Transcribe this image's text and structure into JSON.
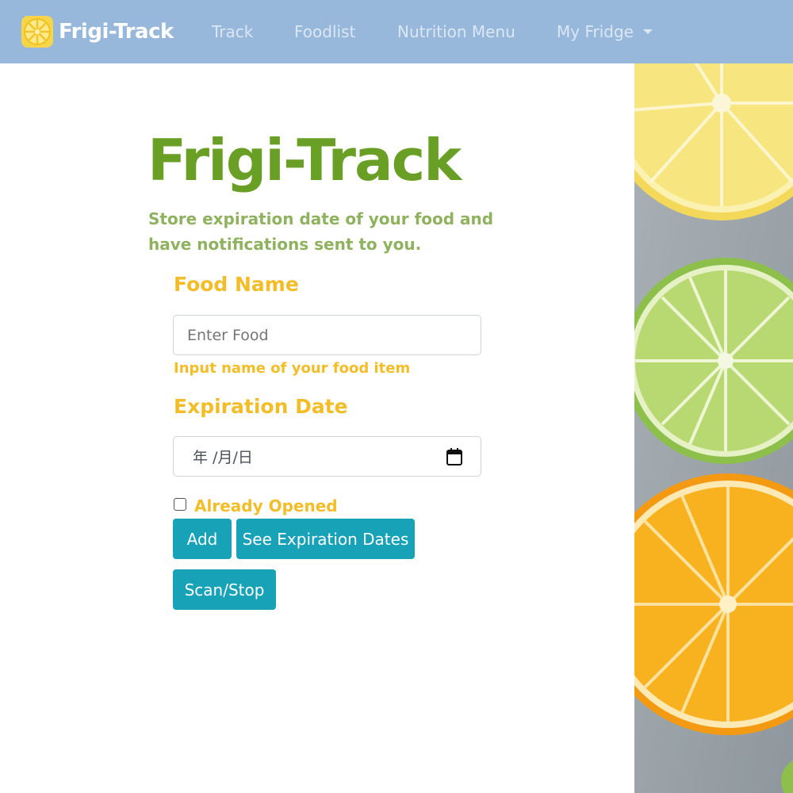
{
  "navbar": {
    "brand": "Frigi-Track",
    "links": [
      "Track",
      "Foodlist",
      "Nutrition Menu",
      "My Fridge"
    ],
    "bg_color": "#97b7db"
  },
  "hero": {
    "title": "Frigi-Track",
    "subtitle": "Store expiration date of your food and have notifications sent to you."
  },
  "form": {
    "food_label": "Food Name",
    "food_placeholder": "Enter Food",
    "food_help": "Input name of your food item",
    "date_label": "Expiration Date",
    "date_value": "年 /月/日",
    "opened_label": "Already Opened",
    "opened_checked": false
  },
  "buttons": {
    "add": "Add",
    "see": "See Expiration Dates",
    "scan": "Scan/Stop"
  },
  "colors": {
    "title_green": "#6a9f25",
    "accent_yellow": "#f3bd27",
    "button_teal": "#17a2b8"
  },
  "icons": [
    "lemon-logo-icon",
    "calendar-icon",
    "caret-down-icon"
  ]
}
